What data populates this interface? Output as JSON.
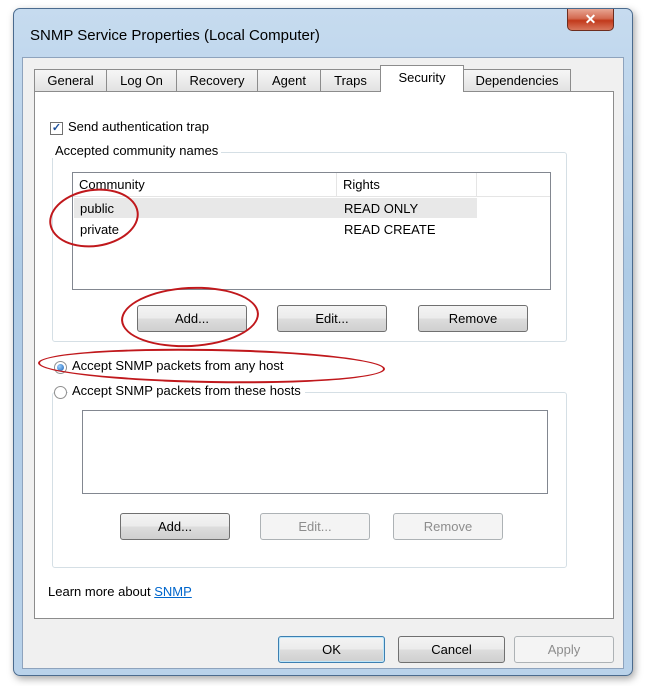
{
  "window": {
    "title": "SNMP Service Properties (Local Computer)",
    "close_glyph": "✕"
  },
  "tabs": [
    {
      "label": "General"
    },
    {
      "label": "Log On"
    },
    {
      "label": "Recovery"
    },
    {
      "label": "Agent"
    },
    {
      "label": "Traps"
    },
    {
      "label": "Security",
      "active": true
    },
    {
      "label": "Dependencies"
    }
  ],
  "security": {
    "send_auth_trap": {
      "label": "Send authentication trap",
      "checked": true,
      "glyph": "✓"
    },
    "community_group": {
      "label": "Accepted community names",
      "columns": [
        "Community",
        "Rights"
      ],
      "rows": [
        {
          "community": "public",
          "rights": "READ ONLY"
        },
        {
          "community": "private",
          "rights": "READ CREATE"
        }
      ],
      "buttons": {
        "add": "Add...",
        "edit": "Edit...",
        "remove": "Remove"
      }
    },
    "accept_any": {
      "label": "Accept SNMP packets from any host",
      "checked": true
    },
    "accept_these": {
      "label": "Accept SNMP packets from these hosts",
      "checked": false
    },
    "hosts_group": {
      "buttons": {
        "add": "Add...",
        "edit": "Edit...",
        "remove": "Remove"
      }
    },
    "learn_more": {
      "prefix": "Learn more about ",
      "link": "SNMP"
    }
  },
  "footer": {
    "ok": "OK",
    "cancel": "Cancel",
    "apply": "Apply"
  },
  "colors": {
    "annotation": "#c0181c",
    "link": "#0066cc"
  }
}
